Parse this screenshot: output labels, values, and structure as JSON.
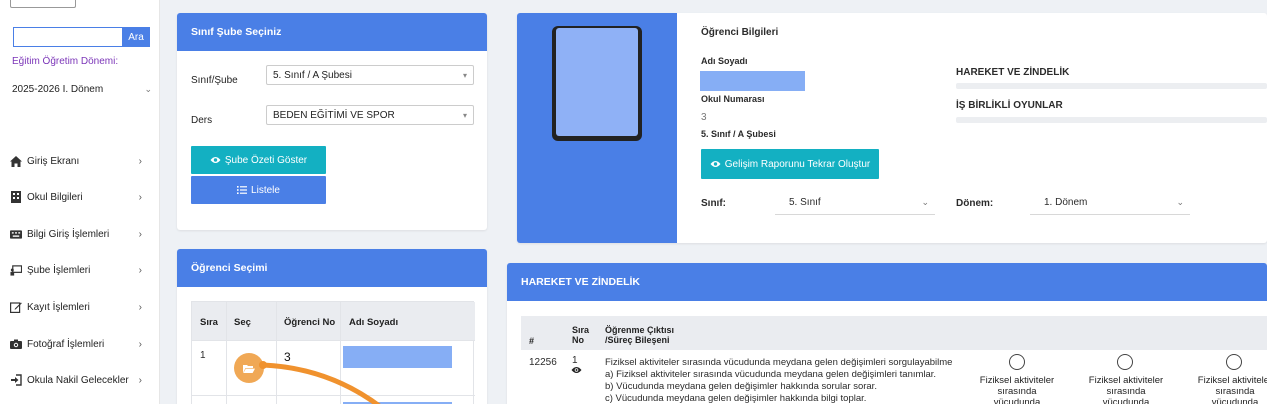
{
  "sidebar": {
    "search_button": "Ara",
    "term_label": "Eğitim Öğretim Dönemi:",
    "term_value": "2025-2026 I. Dönem",
    "items": [
      {
        "label": "Giriş Ekranı",
        "icon": "home-icon"
      },
      {
        "label": "Okul Bilgileri",
        "icon": "building-icon"
      },
      {
        "label": "Bilgi Giriş İşlemleri",
        "icon": "keyboard-icon"
      },
      {
        "label": "Şube İşlemleri",
        "icon": "chalkboard-icon"
      },
      {
        "label": "Kayıt İşlemleri",
        "icon": "edit-icon"
      },
      {
        "label": "Fotoğraf İşlemleri",
        "icon": "camera-icon"
      },
      {
        "label": "Okula Nakil Gelecekler",
        "icon": "sign-in-icon"
      }
    ]
  },
  "class_panel": {
    "title": "Sınıf Şube Seçiniz",
    "class_label": "Sınıf/Şube",
    "class_value": "5. Sınıf / A Şubesi",
    "course_label": "Ders",
    "course_value": "BEDEN EĞİTİMİ VE SPOR",
    "summary_button": "Şube Özeti Göster",
    "list_button": "Listele"
  },
  "student_select": {
    "title": "Öğrenci Seçimi",
    "headers": [
      "Sıra",
      "Seç",
      "Öğrenci No",
      "Adı Soyadı"
    ],
    "rows": [
      {
        "order": "1",
        "number": "3"
      }
    ]
  },
  "student_info": {
    "title": "Öğrenci Bilgileri",
    "name_label": "Adı Soyadı",
    "number_label": "Okul Numarası",
    "number_value": "3",
    "class_text": "5. Sınıf / A Şubesi",
    "report_button": "Gelişim Raporunu Tekrar Oluştur",
    "filter_class_label": "Sınıf:",
    "filter_class_value": "5. Sınıf",
    "filter_term_label": "Dönem:",
    "filter_term_value": "1. Dönem",
    "skills": [
      {
        "label": "HAREKET VE ZİNDELİK"
      },
      {
        "label": "İŞ BİRLİKLİ OYUNLAR"
      }
    ]
  },
  "outcomes": {
    "title": "HAREKET VE ZİNDELİK",
    "headers": {
      "id": "#",
      "order": "Sıra No",
      "outcome": "Öğrenme Çıktısı /Süreç Bileşeni"
    },
    "row": {
      "id": "12256",
      "order": "1",
      "lines": [
        "Fiziksel aktiviteler sırasında vücudunda meydana gelen değişimleri sorgulayabilme",
        "a) Fiziksel aktiviteler sırasında vücudunda meydana gelen değişimleri tanımlar.",
        "b) Vücudunda meydana gelen değişimler hakkında sorular sorar.",
        "c) Vücudunda meydana gelen değişimler hakkında bilgi toplar."
      ],
      "options": [
        "Fiziksel aktiviteler sırasında vücudunda meydana gelen",
        "Fiziksel aktiviteler sırasında vücudunda meydana gelen",
        "Fiziksel aktiviteler sırasında vücudunda meydana gelen"
      ]
    }
  },
  "colors": {
    "primary": "#4a7fe6",
    "teal": "#13b0c2",
    "accent_orange": "#f0922e",
    "term_purple": "#7b35b8"
  }
}
